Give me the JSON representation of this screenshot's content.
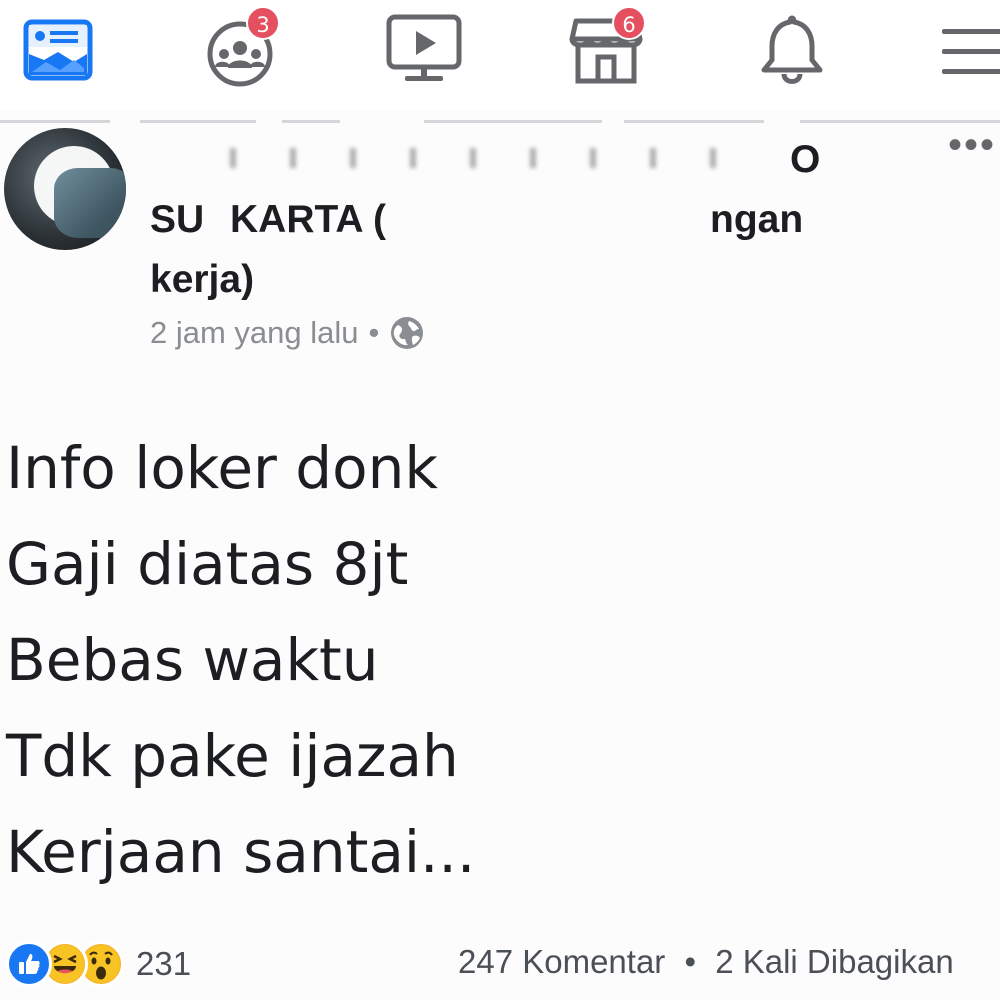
{
  "topnav": {
    "items": [
      {
        "name": "news-feed",
        "icon": "news-feed-icon",
        "badge": null
      },
      {
        "name": "groups",
        "icon": "groups-icon",
        "badge": "3"
      },
      {
        "name": "watch",
        "icon": "watch-video-icon",
        "badge": null
      },
      {
        "name": "marketplace",
        "icon": "marketplace-icon",
        "badge": "6"
      },
      {
        "name": "notifications",
        "icon": "bell-icon",
        "badge": null
      },
      {
        "name": "menu",
        "icon": "menu-icon",
        "badge": null
      }
    ],
    "accent_color": "#1877f2",
    "badge_color": "#e4505f"
  },
  "post": {
    "title_fragment_end": "O",
    "title_line2_start": "SU",
    "title_line2_mid": "KARTA (",
    "title_line2_end": "ngan",
    "title_line3": "kerja)",
    "timestamp": "2 jam yang lalu",
    "meta_separator": "•",
    "privacy_icon": "globe-icon",
    "more_label": "•••",
    "body_lines": [
      "Info loker donk",
      "Gaji diatas 8jt",
      "Bebas waktu",
      "Tdk pake ijazah",
      "Kerjaan santai..."
    ]
  },
  "footer": {
    "reaction_icons": [
      "like-icon",
      "haha-icon",
      "wow-icon"
    ],
    "reaction_count": "231",
    "comments": "247 Komentar",
    "separator": "•",
    "shares": "2 Kali Dibagikan"
  }
}
